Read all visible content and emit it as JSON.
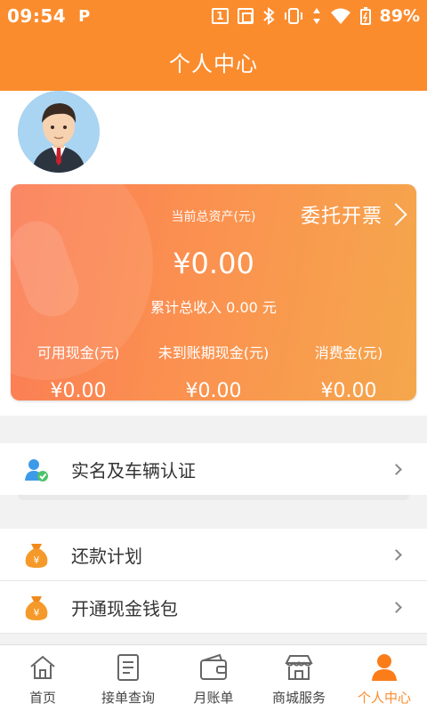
{
  "status_bar": {
    "time": "09:54",
    "app_glyph": "P",
    "sim": "1",
    "battery_percent": "89%"
  },
  "header": {
    "title": "个人中心"
  },
  "asset_card": {
    "total_label": "当前总资产(元)",
    "total_value": "¥0.00",
    "invoice_link": "委托开票",
    "cumulative_income": "累计总收入 0.00 元",
    "metrics": [
      {
        "label": "可用现金(元)",
        "value": "¥0.00"
      },
      {
        "label": "未到账期现金(元)",
        "value": "¥0.00"
      },
      {
        "label": "消费金(元)",
        "value": "¥0.00"
      }
    ]
  },
  "menu": [
    {
      "label": "实名及车辆认证",
      "icon": "user-verified-icon"
    },
    {
      "label": "还款计划",
      "icon": "money-bag-icon"
    },
    {
      "label": "开通现金钱包",
      "icon": "money-bag-icon"
    }
  ],
  "tabbar": {
    "tabs": [
      {
        "label": "首页",
        "icon": "home-icon",
        "active": false
      },
      {
        "label": "接单查询",
        "icon": "document-icon",
        "active": false
      },
      {
        "label": "月账单",
        "icon": "wallet-icon",
        "active": false
      },
      {
        "label": "商城服务",
        "icon": "store-icon",
        "active": false
      },
      {
        "label": "个人中心",
        "icon": "person-icon",
        "active": true
      }
    ]
  },
  "colors": {
    "brand_orange": "#fb8c2e",
    "card_gradient_start": "#fb7c55",
    "card_gradient_end": "#f5a74c",
    "verify_blue": "#3d9ae8",
    "verify_green": "#4cc36a"
  }
}
